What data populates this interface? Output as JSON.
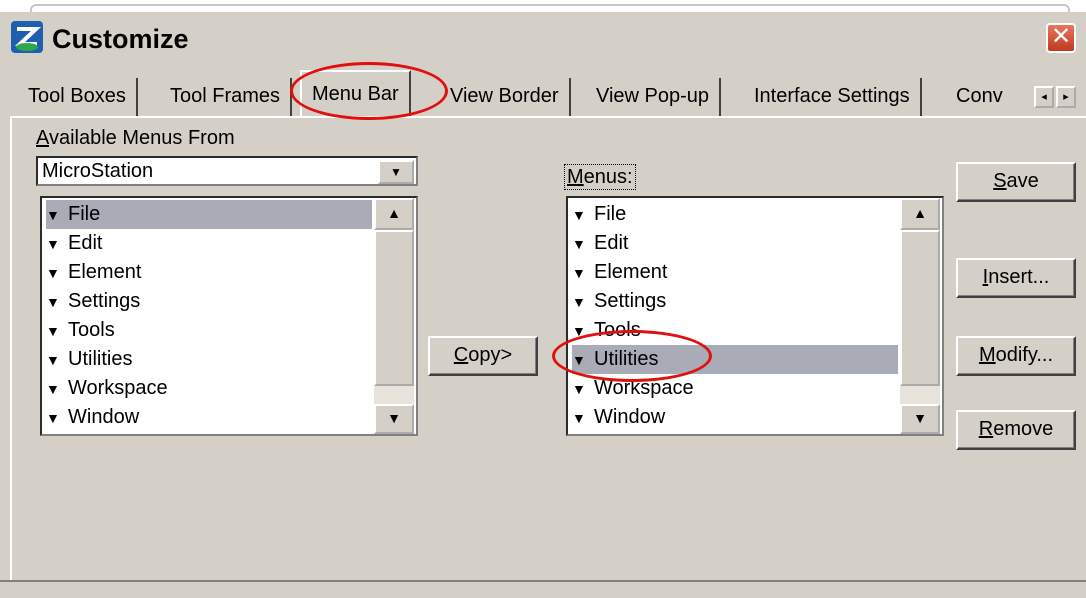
{
  "window": {
    "title": "Customize",
    "close_glyph": "✕",
    "icon": "microstation-app-icon"
  },
  "tabs": [
    {
      "label": "Tool Boxes"
    },
    {
      "label": "Tool Frames"
    },
    {
      "label": "Menu Bar",
      "selected": true
    },
    {
      "label": "View Border"
    },
    {
      "label": "View Pop-up"
    },
    {
      "label": "Interface Settings"
    },
    {
      "label": "Conv"
    }
  ],
  "tab_scroll": {
    "left_glyph": "◂",
    "right_glyph": "▸"
  },
  "left_panel": {
    "label_prefix": "A",
    "label_rest": "vailable Menus From",
    "dropdown_value": "MicroStation",
    "dropdown_glyph": "▼",
    "items": [
      {
        "label": "File",
        "selected": true
      },
      {
        "label": "Edit"
      },
      {
        "label": "Element"
      },
      {
        "label": "Settings"
      },
      {
        "label": "Tools"
      },
      {
        "label": "Utilities"
      },
      {
        "label": "Workspace"
      },
      {
        "label": "Window"
      }
    ]
  },
  "right_panel": {
    "label_prefix": "M",
    "label_rest": "enus:",
    "items": [
      {
        "label": "File"
      },
      {
        "label": "Edit"
      },
      {
        "label": "Element"
      },
      {
        "label": "Settings"
      },
      {
        "label": "Tools"
      },
      {
        "label": "Utilities",
        "selected": true
      },
      {
        "label": "Workspace"
      },
      {
        "label": "Window"
      }
    ]
  },
  "item_glyph": "▼",
  "scroll_up_glyph": "▲",
  "scroll_down_glyph": "▼",
  "buttons": {
    "copy": {
      "prefix": "C",
      "rest": "opy>"
    },
    "save": {
      "prefix": "S",
      "rest": "ave"
    },
    "insert": {
      "prefix": "I",
      "rest": "nsert..."
    },
    "modify": {
      "prefix": "M",
      "rest": "odify..."
    },
    "remove": {
      "prefix": "R",
      "rest": "emove"
    }
  },
  "colors": {
    "annotation": "#e01010",
    "selection": "#a9acb6",
    "face": "#d4d0c8"
  }
}
